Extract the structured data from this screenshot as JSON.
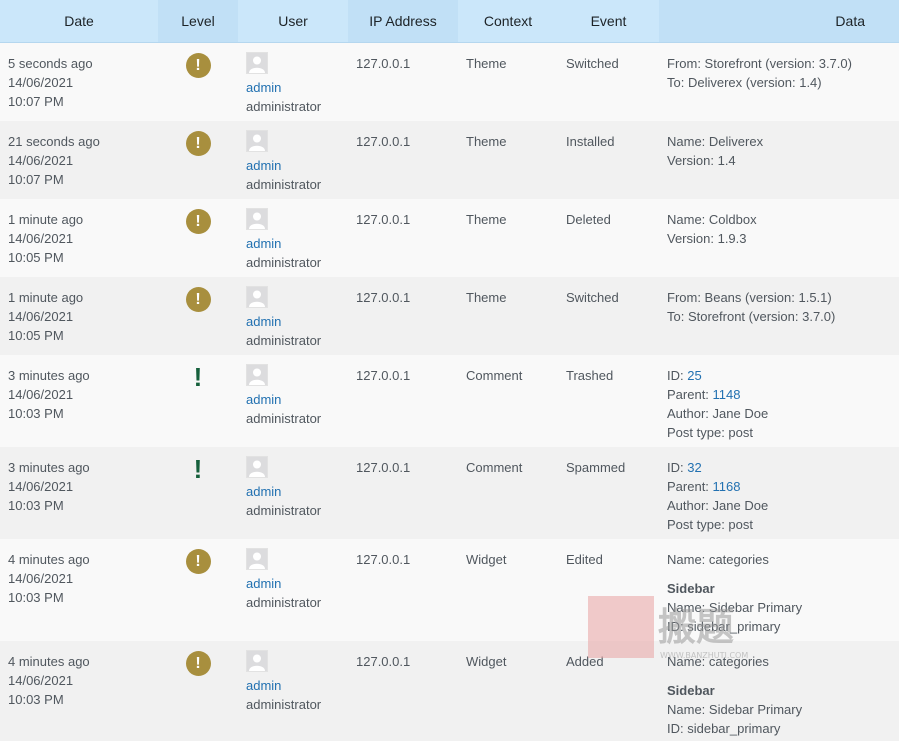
{
  "columns": {
    "date": "Date",
    "level": "Level",
    "user": "User",
    "ip": "IP Address",
    "context": "Context",
    "event": "Event",
    "data": "Data"
  },
  "rows": [
    {
      "date_relative": "5 seconds ago",
      "date": "14/06/2021",
      "time": "10:07 PM",
      "level": "warning",
      "level_icon": "exclamation-circle-icon",
      "user": "admin",
      "role": "administrator",
      "ip": "127.0.0.1",
      "context": "Theme",
      "event": "Switched",
      "data_lines": [
        {
          "label": "From: Storefront (version: 3.7.0)"
        },
        {
          "label": "To: Deliverex (version: 1.4)"
        }
      ]
    },
    {
      "date_relative": "21 seconds ago",
      "date": "14/06/2021",
      "time": "10:07 PM",
      "level": "warning",
      "level_icon": "exclamation-circle-icon",
      "user": "admin",
      "role": "administrator",
      "ip": "127.0.0.1",
      "context": "Theme",
      "event": "Installed",
      "data_lines": [
        {
          "label": "Name: Deliverex"
        },
        {
          "label": "Version: 1.4"
        }
      ]
    },
    {
      "date_relative": "1 minute ago",
      "date": "14/06/2021",
      "time": "10:05 PM",
      "level": "warning",
      "level_icon": "exclamation-circle-icon",
      "user": "admin",
      "role": "administrator",
      "ip": "127.0.0.1",
      "context": "Theme",
      "event": "Deleted",
      "data_lines": [
        {
          "label": "Name: Coldbox"
        },
        {
          "label": "Version: 1.9.3"
        }
      ]
    },
    {
      "date_relative": "1 minute ago",
      "date": "14/06/2021",
      "time": "10:05 PM",
      "level": "warning",
      "level_icon": "exclamation-circle-icon",
      "user": "admin",
      "role": "administrator",
      "ip": "127.0.0.1",
      "context": "Theme",
      "event": "Switched",
      "data_lines": [
        {
          "label": "From: Beans (version: 1.5.1)"
        },
        {
          "label": "To: Storefront (version: 3.7.0)"
        }
      ]
    },
    {
      "date_relative": "3 minutes ago",
      "date": "14/06/2021",
      "time": "10:03 PM",
      "level": "notice",
      "level_icon": "exclamation-icon",
      "user": "admin",
      "role": "administrator",
      "ip": "127.0.0.1",
      "context": "Comment",
      "event": "Trashed",
      "data_lines": [
        {
          "label": "ID: ",
          "link": "25"
        },
        {
          "label": "Parent: ",
          "link": "1148"
        },
        {
          "label": "Author: Jane Doe"
        },
        {
          "label": "Post type: post"
        }
      ]
    },
    {
      "date_relative": "3 minutes ago",
      "date": "14/06/2021",
      "time": "10:03 PM",
      "level": "notice",
      "level_icon": "exclamation-icon",
      "user": "admin",
      "role": "administrator",
      "ip": "127.0.0.1",
      "context": "Comment",
      "event": "Spammed",
      "data_lines": [
        {
          "label": "ID: ",
          "link": "32"
        },
        {
          "label": "Parent: ",
          "link": "1168"
        },
        {
          "label": "Author: Jane Doe"
        },
        {
          "label": "Post type: post"
        }
      ]
    },
    {
      "date_relative": "4 minutes ago",
      "date": "14/06/2021",
      "time": "10:03 PM",
      "level": "warning",
      "level_icon": "exclamation-circle-icon",
      "user": "admin",
      "role": "administrator",
      "ip": "127.0.0.1",
      "context": "Widget",
      "event": "Edited",
      "data_lines": [
        {
          "label": "Name: categories"
        },
        {
          "gap": true
        },
        {
          "label": "Sidebar",
          "bold": true
        },
        {
          "label": "Name: Sidebar Primary"
        },
        {
          "label": "ID: sidebar_primary"
        }
      ]
    },
    {
      "date_relative": "4 minutes ago",
      "date": "14/06/2021",
      "time": "10:03 PM",
      "level": "warning",
      "level_icon": "exclamation-circle-icon",
      "user": "admin",
      "role": "administrator",
      "ip": "127.0.0.1",
      "context": "Widget",
      "event": "Added",
      "data_lines": [
        {
          "label": "Name: categories"
        },
        {
          "gap": true
        },
        {
          "label": "Sidebar",
          "bold": true
        },
        {
          "label": "Name: Sidebar Primary"
        },
        {
          "label": "ID: sidebar_primary"
        }
      ]
    }
  ],
  "watermark": {
    "text": "WWW.BANZHUTI.COM"
  },
  "colors": {
    "header_bg": "#cbe7fa",
    "link": "#2271b1",
    "warning": "#a88f3e",
    "notice": "#16603c"
  }
}
